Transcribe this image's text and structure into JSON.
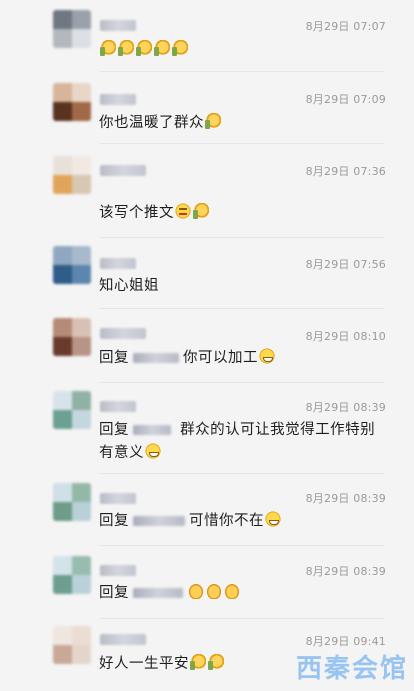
{
  "comments": [
    {
      "time": "8月29日 07:07",
      "emojis": [
        "thumbs-up",
        "thumbs-up",
        "thumbs-up",
        "thumbs-up",
        "thumbs-up"
      ]
    },
    {
      "time": "8月29日 07:09",
      "text": "你也温暖了群众"
    },
    {
      "time": "8月29日 07:36",
      "text": "该写个推文"
    },
    {
      "time": "8月29日 07:56",
      "text": "知心姐姐"
    },
    {
      "time": "8月29日 08:10",
      "reply_prefix": "回复",
      "text": "你可以加工"
    },
    {
      "time": "8月29日 08:39",
      "reply_prefix": "回复",
      "text": "群众的认可让我觉得工作特别",
      "text_line2": "有意义"
    },
    {
      "time": "8月29日 08:39",
      "reply_prefix": "回复",
      "text": "可惜你不在"
    },
    {
      "time": "8月29日 08:39",
      "reply_prefix": "回复"
    },
    {
      "time": "8月29日 09:41",
      "text": "好人一生平安"
    }
  ],
  "watermark": "西秦会馆",
  "colors": {
    "background": "#f4f4f4",
    "text": "#1e1e1e",
    "time": "#9a9a9a",
    "watermark": "#78b4f0"
  }
}
